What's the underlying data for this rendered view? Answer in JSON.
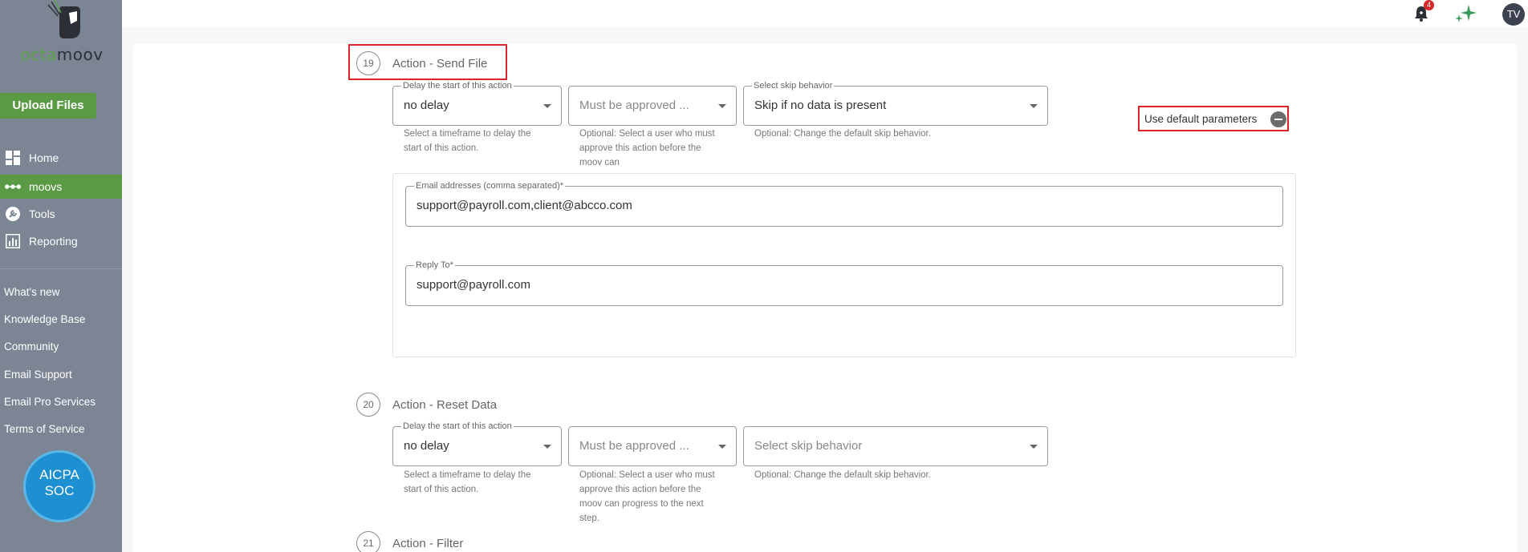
{
  "brand": {
    "logo_part1": "octa",
    "logo_part2": "moov"
  },
  "sidebar": {
    "upload_label": "Upload Files",
    "nav": [
      {
        "label": "Home",
        "icon": "dashboard-icon"
      },
      {
        "label": "moovs",
        "icon": "dots-icon",
        "active": true
      },
      {
        "label": "Tools",
        "icon": "wrench-icon"
      },
      {
        "label": "Reporting",
        "icon": "chart-icon"
      }
    ],
    "links": [
      "What's new",
      "Knowledge Base",
      "Community",
      "Email Support",
      "Email Pro Services",
      "Terms of Service"
    ],
    "badge": {
      "line1": "AICPA",
      "line2": "SOC"
    }
  },
  "topbar": {
    "notification_count": "4",
    "avatar_initials": "TV"
  },
  "steps": [
    {
      "number": "19",
      "title": "Action - Send File",
      "delay": {
        "legend": "Delay the start of this action",
        "value": "no delay",
        "help": "Select a timeframe to delay the start of this action."
      },
      "approval": {
        "placeholder": "Must be approved ...",
        "help": "Optional: Select a user who must approve this action before the moov can"
      },
      "skip": {
        "legend": "Select skip behavior",
        "value": "Skip if no data is present",
        "help": "Optional: Change the default skip behavior."
      },
      "use_default_label": "Use default parameters",
      "email": {
        "legend": "Email addresses (comma separated)*",
        "value": "support@payroll.com,client@abcco.com"
      },
      "reply_to": {
        "legend": "Reply To*",
        "value": "support@payroll.com"
      }
    },
    {
      "number": "20",
      "title": "Action - Reset Data",
      "delay": {
        "legend": "Delay the start of this action",
        "value": "no delay",
        "help": "Select a timeframe to delay the start of this action."
      },
      "approval": {
        "placeholder": "Must be approved ...",
        "help": "Optional: Select a user who must approve this action before the moov can progress to the next step."
      },
      "skip": {
        "placeholder": "Select skip behavior",
        "help": "Optional: Change the default skip behavior."
      }
    },
    {
      "number": "21",
      "title": "Action - Filter"
    }
  ],
  "colors": {
    "sidebar": "#7b8594",
    "accent": "#5a9a44",
    "highlight": "#d9232e"
  }
}
